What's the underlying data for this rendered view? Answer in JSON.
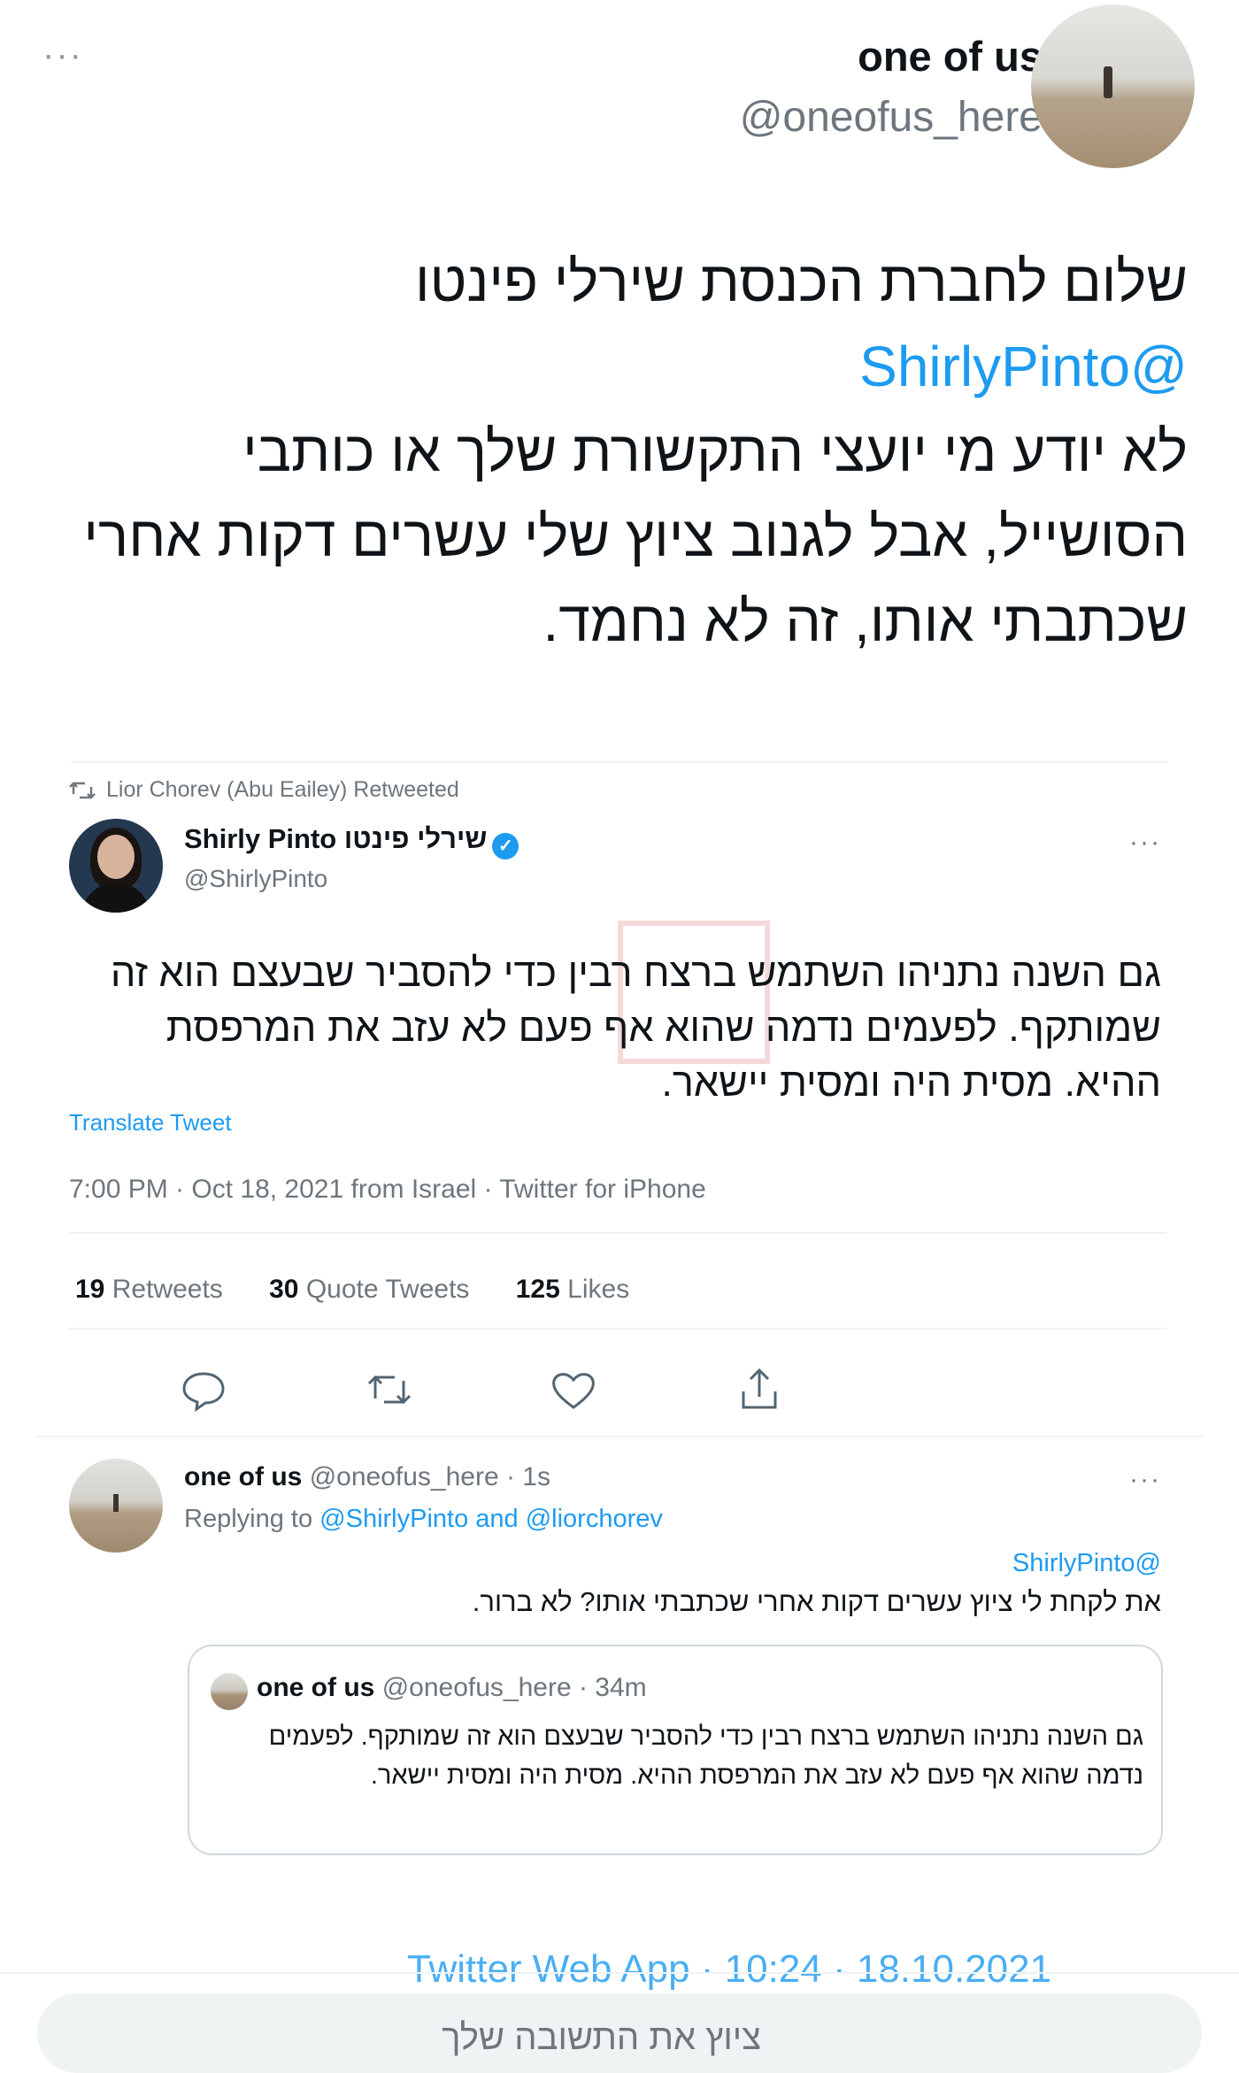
{
  "header": {
    "author_name": "one of us",
    "author_handle": "@oneofus_here",
    "more_label": "···"
  },
  "main_tweet": {
    "line1": "שלום לחברת הכנסת שירלי פינטו",
    "mention": "@ShirlyPinto",
    "line2": "לא יודע מי יועצי התקשורת שלך או כותבי הסושייל, אבל לגנוב ציוץ שלי עשרים דקות אחרי שכתבתי אותו, זה לא נחמד."
  },
  "embedded": {
    "retweeted_by": "Lior Chorev (Abu Eailey) Retweeted",
    "name": "Shirly Pinto שירלי פינטו",
    "handle": "@ShirlyPinto",
    "text": "גם השנה נתניהו השתמש ברצח רבין כדי להסביר שבעצם הוא זה שמותקף. לפעמים נדמה שהוא אף פעם לא עזב את המרפסת ההיא. מסית היה ומסית יישאר.",
    "translate": "Translate Tweet",
    "meta": "7:00 PM · Oct 18, 2021 from Israel · Twitter for iPhone",
    "stats": {
      "retweets_num": "19",
      "retweets_label": "Retweets",
      "quotes_num": "30",
      "quotes_label": "Quote Tweets",
      "likes_num": "125",
      "likes_label": "Likes"
    },
    "reply": {
      "name": "one of us",
      "meta": "@oneofus_here · 1s",
      "replying_prefix": "Replying to",
      "replying_targets": "@ShirlyPinto and @liorchorev",
      "mention": "@ShirlyPinto",
      "text": "את לקחת לי ציוץ עשרים דקות אחרי שכתבתי אותו? לא ברור."
    },
    "quote": {
      "name": "one of us",
      "meta": "@oneofus_here · 34m",
      "text": "גם השנה נתניהו השתמש ברצח רבין כדי להסביר שבעצם הוא זה שמותקף. לפעמים נדמה שהוא אף פעם לא עזב את המרפסת ההיא. מסית היה ומסית יישאר."
    }
  },
  "footer": {
    "partial_meta": "Twitter Web App · 10:24 · 18.10.2021",
    "reply_placeholder": "ציוץ את התשובה שלך"
  },
  "colors": {
    "accent": "#1d9bf0",
    "text": "#0f1419",
    "muted": "#6e767d",
    "border": "#cfd9de"
  },
  "icons": [
    "more-icon",
    "retweet-icon",
    "verified-icon",
    "reply-icon",
    "like-icon",
    "share-icon"
  ]
}
